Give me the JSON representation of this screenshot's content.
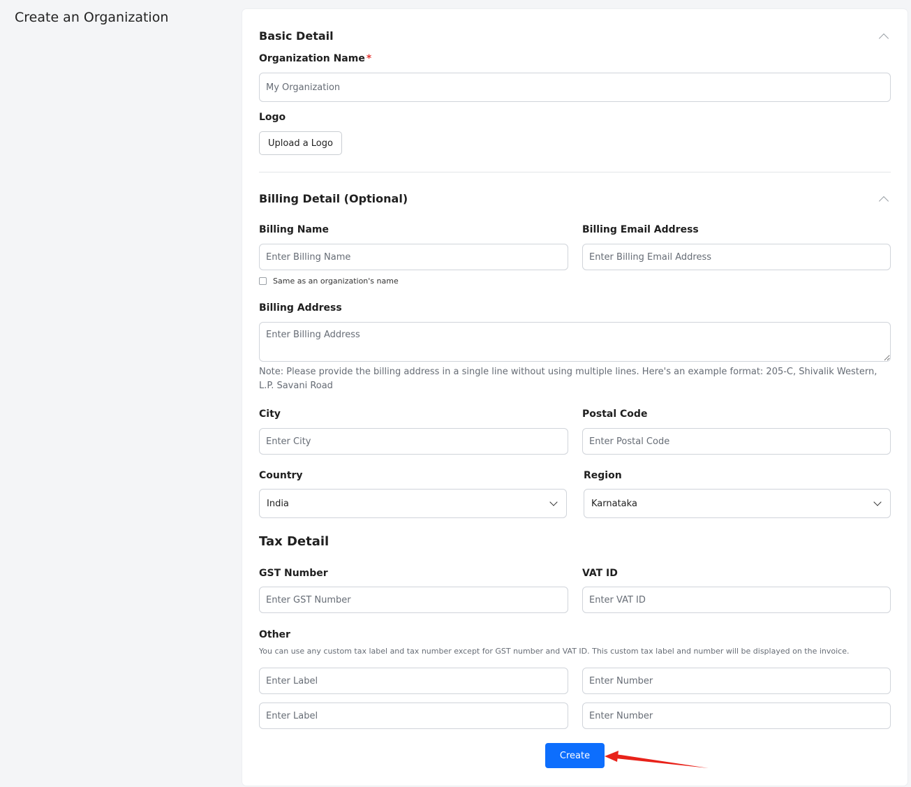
{
  "page": {
    "title": "Create an Organization"
  },
  "basic": {
    "title": "Basic Detail",
    "org_name_label": "Organization Name",
    "required_mark": "*",
    "org_name_placeholder": "My Organization",
    "logo_label": "Logo",
    "upload_label": "Upload a Logo"
  },
  "billing": {
    "title": "Billing Detail (Optional)",
    "name_label": "Billing Name",
    "name_placeholder": "Enter Billing Name",
    "email_label": "Billing Email Address",
    "email_placeholder": "Enter Billing Email Address",
    "same_as_label": "Same as an organization's name",
    "address_label": "Billing Address",
    "address_placeholder": "Enter Billing Address",
    "note": "Note: Please provide the billing address in a single line without using multiple lines. Here's an example format: 205-C, Shivalik Western, L.P. Savani Road",
    "city_label": "City",
    "city_placeholder": "Enter City",
    "postal_label": "Postal Code",
    "postal_placeholder": "Enter Postal Code",
    "country_label": "Country",
    "country_value": "India",
    "region_label": "Region",
    "region_value": "Karnataka"
  },
  "tax": {
    "title": "Tax Detail",
    "gst_label": "GST Number",
    "gst_placeholder": "Enter GST Number",
    "vat_label": "VAT ID",
    "vat_placeholder": "Enter VAT ID",
    "other_label": "Other",
    "other_help": "You can use any custom tax label and tax number except for GST number and VAT ID. This custom tax label and number will be displayed on the invoice.",
    "rows": [
      {
        "label_placeholder": "Enter Label",
        "number_placeholder": "Enter Number"
      },
      {
        "label_placeholder": "Enter Label",
        "number_placeholder": "Enter Number"
      }
    ]
  },
  "actions": {
    "create_label": "Create"
  },
  "colors": {
    "primary": "#0d6efd",
    "required": "#e53935",
    "annotation_arrow": "#e8221a"
  }
}
